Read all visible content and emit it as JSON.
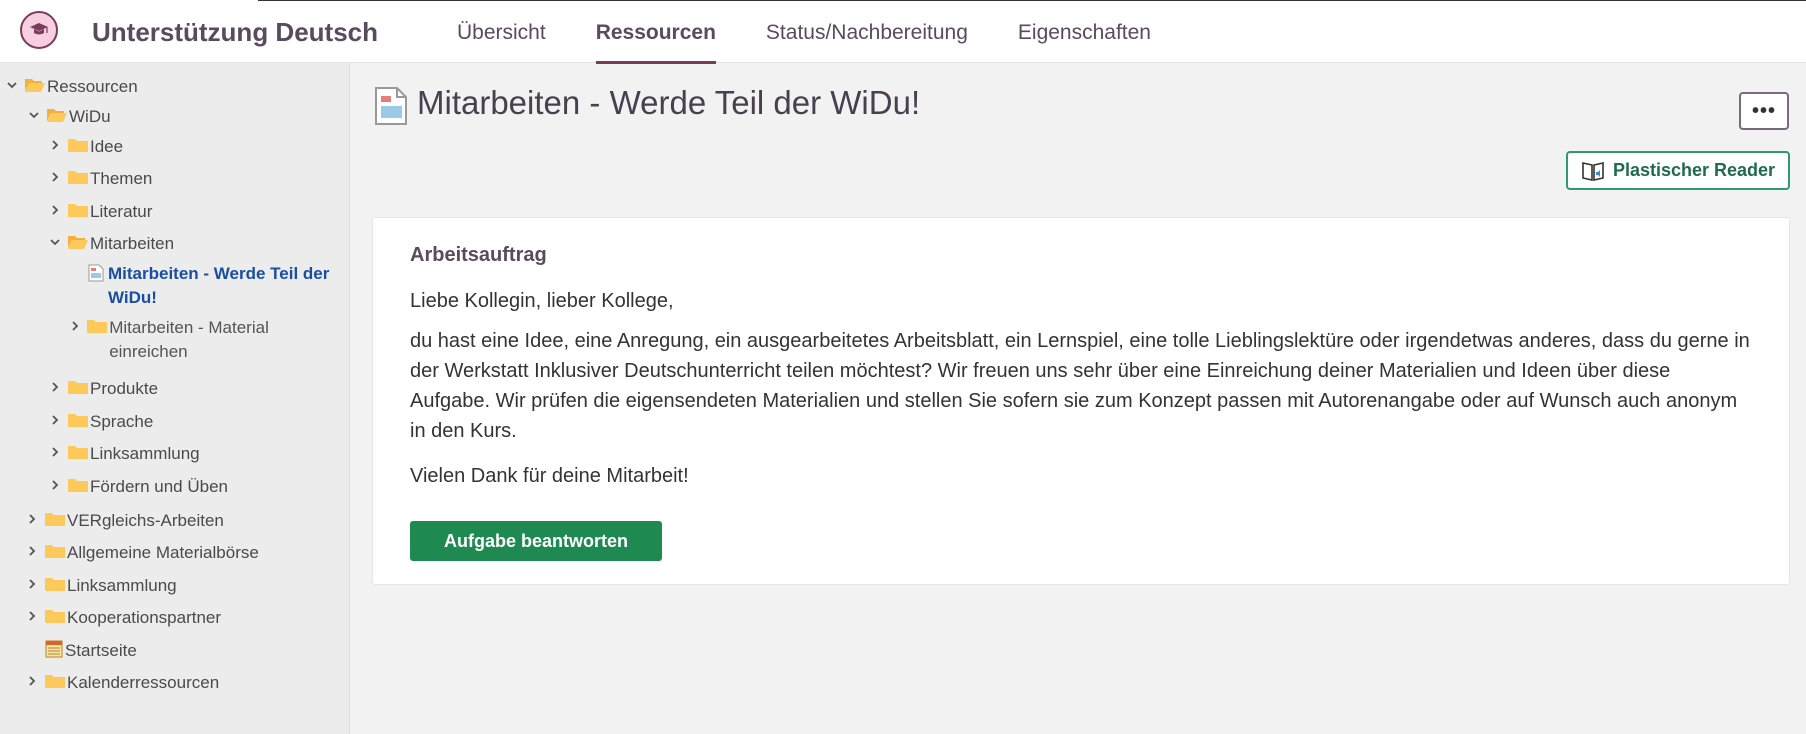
{
  "header": {
    "course_title": "Unterstützung Deutsch",
    "logo_icon": "graduation-cap-icon",
    "nav": [
      {
        "label": "Übersicht",
        "active": false
      },
      {
        "label": "Ressourcen",
        "active": true
      },
      {
        "label": "Status/Nachbereitung",
        "active": false
      },
      {
        "label": "Eigenschaften",
        "active": false
      }
    ]
  },
  "sidebar": {
    "items": [
      {
        "label": "Ressourcen"
      },
      {
        "label": "WiDu"
      },
      {
        "label": "Idee"
      },
      {
        "label": "Themen"
      },
      {
        "label": "Literatur"
      },
      {
        "label": "Mitarbeiten"
      },
      {
        "label": "Mitarbeiten - Werde Teil der WiDu!"
      },
      {
        "label": "Mitarbeiten - Material einreichen"
      },
      {
        "label": "Produkte"
      },
      {
        "label": "Sprache"
      },
      {
        "label": "Linksammlung"
      },
      {
        "label": "Fördern und Üben"
      },
      {
        "label": "VERgleichs-Arbeiten"
      },
      {
        "label": "Allgemeine Materialbörse"
      },
      {
        "label": "Linksammlung"
      },
      {
        "label": "Kooperationspartner"
      },
      {
        "label": "Startseite"
      },
      {
        "label": "Kalenderressourcen"
      }
    ]
  },
  "main": {
    "title": "Mitarbeiten - Werde Teil der WiDu!",
    "more_label": "•••",
    "reader_label": "Plastischer Reader",
    "card": {
      "heading": "Arbeitsauftrag",
      "greeting": "Liebe Kollegin, lieber Kollege,",
      "body": "du hast eine Idee, eine Anregung, ein ausgearbeitetes Arbeitsblatt, ein Lernspiel, eine tolle Lieblingslektüre oder irgendetwas anderes, dass du gerne in der Werkstatt Inklusiver Deutschunterricht teilen möchtest? Wir freuen uns sehr über eine Einreichung deiner Materialien und Ideen über diese Aufgabe. Wir prüfen die eigensendeten Materialien und stellen Sie sofern sie zum Konzept passen mit Autorenangabe oder auf Wunsch auch anonym in den Kurs.",
      "thanks": "Vielen Dank für deine Mitarbeit!",
      "button_label": "Aufgabe beantworten"
    }
  },
  "colors": {
    "accent": "#7a3c5a",
    "link_active": "#1a4ea3",
    "button_green": "#1e8a52",
    "reader_border": "#2e9a6e"
  }
}
